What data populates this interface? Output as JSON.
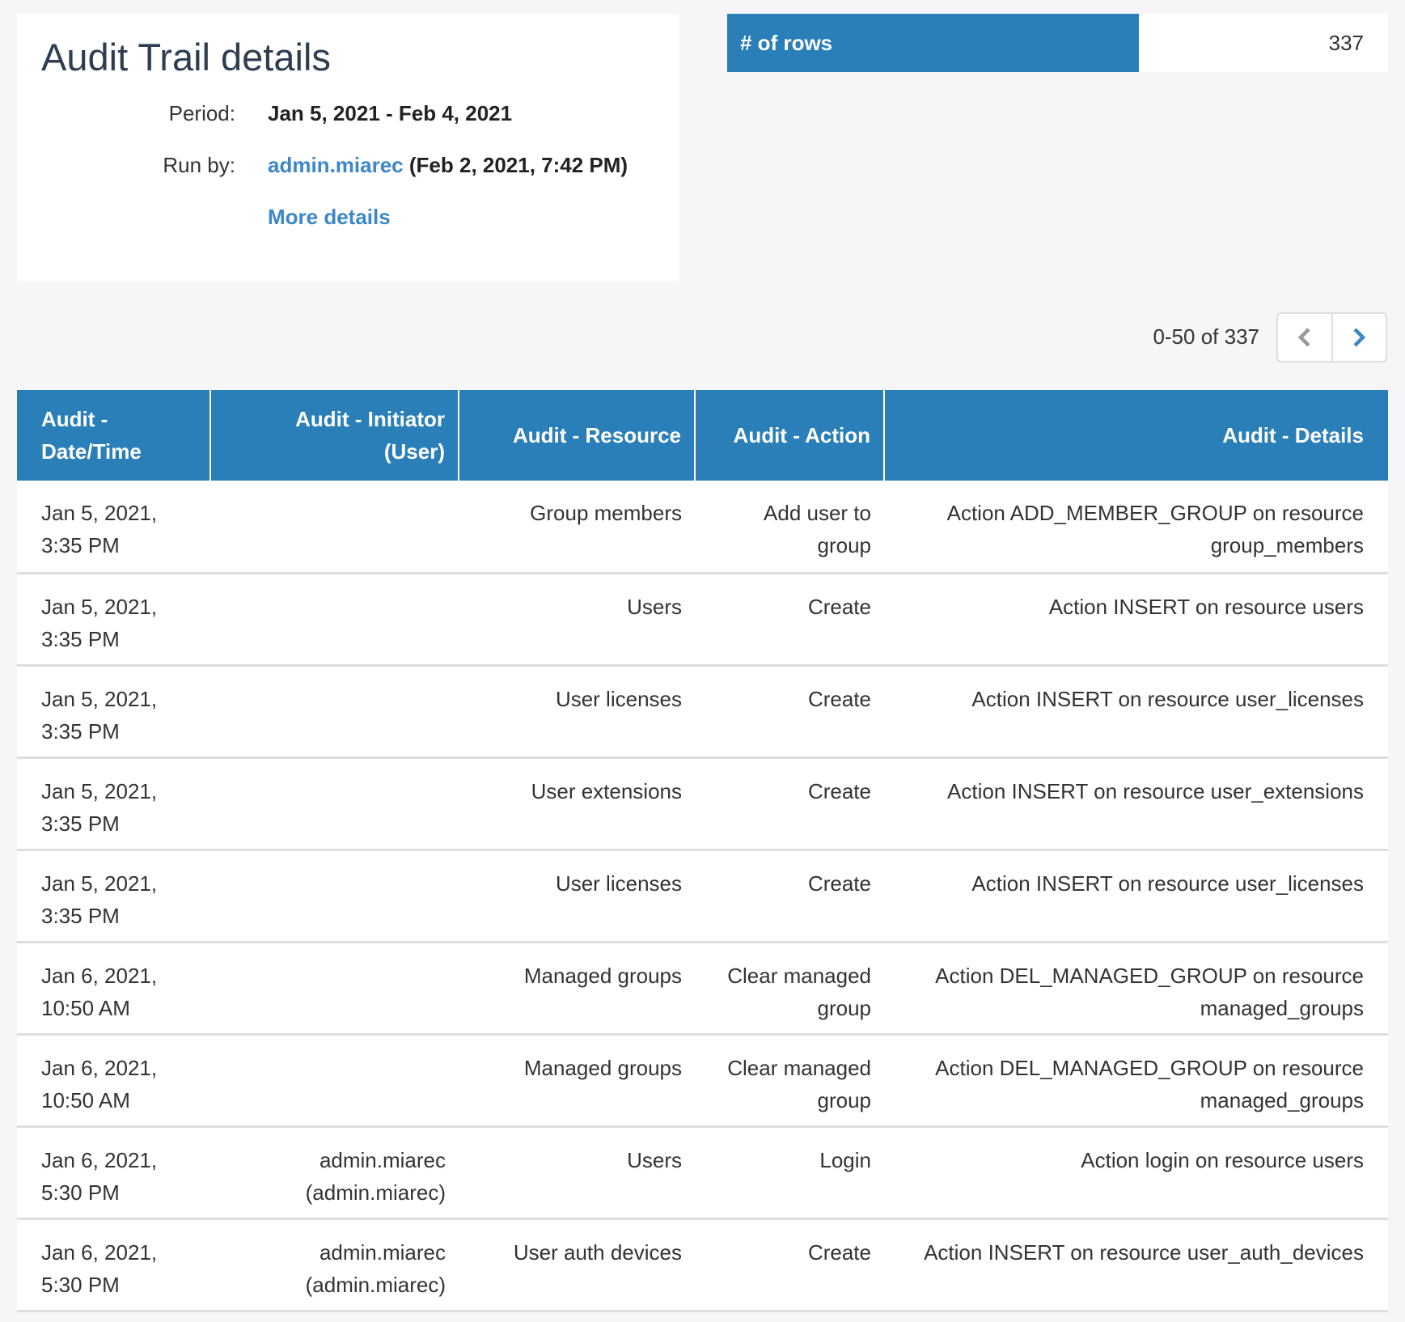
{
  "report": {
    "title": "Audit Trail details",
    "period_label": "Period:",
    "period_value": "Jan 5, 2021 - Feb 4, 2021",
    "run_by_label": "Run by:",
    "run_by_user": "admin.miarec",
    "run_by_time": "(Feb 2, 2021, 7:42 PM)",
    "more_details": "More details"
  },
  "summary": {
    "rows_label": "# of rows",
    "rows_value": "337"
  },
  "pagination": {
    "range_text": "0-50 of 337",
    "prev_icon": "chevron-left-icon",
    "next_icon": "chevron-right-icon"
  },
  "colors": {
    "header_blue": "#2a7fb8",
    "link_blue": "#3d87c9"
  },
  "table": {
    "columns": [
      "Audit - Date/Time",
      "Audit - Initiator (User)",
      "Audit - Resource",
      "Audit - Action",
      "Audit - Details"
    ],
    "rows": [
      {
        "datetime": "Jan 5, 2021, 3:35 PM",
        "initiator": "",
        "resource": "Group members",
        "action": "Add user to group",
        "details": "Action ADD_MEMBER_GROUP on resource group_members"
      },
      {
        "datetime": "Jan 5, 2021, 3:35 PM",
        "initiator": "",
        "resource": "Users",
        "action": "Create",
        "details": "Action INSERT on resource users"
      },
      {
        "datetime": "Jan 5, 2021, 3:35 PM",
        "initiator": "",
        "resource": "User licenses",
        "action": "Create",
        "details": "Action INSERT on resource user_licenses"
      },
      {
        "datetime": "Jan 5, 2021, 3:35 PM",
        "initiator": "",
        "resource": "User extensions",
        "action": "Create",
        "details": "Action INSERT on resource user_extensions"
      },
      {
        "datetime": "Jan 5, 2021, 3:35 PM",
        "initiator": "",
        "resource": "User licenses",
        "action": "Create",
        "details": "Action INSERT on resource user_licenses"
      },
      {
        "datetime": "Jan 6, 2021, 10:50 AM",
        "initiator": "",
        "resource": "Managed groups",
        "action": "Clear managed group",
        "details": "Action DEL_MANAGED_GROUP on resource managed_groups"
      },
      {
        "datetime": "Jan 6, 2021, 10:50 AM",
        "initiator": "",
        "resource": "Managed groups",
        "action": "Clear managed group",
        "details": "Action DEL_MANAGED_GROUP on resource managed_groups"
      },
      {
        "datetime": "Jan 6, 2021, 5:30 PM",
        "initiator": "admin.miarec (admin.miarec)",
        "resource": "Users",
        "action": "Login",
        "details": "Action login on resource users"
      },
      {
        "datetime": "Jan 6, 2021, 5:30 PM",
        "initiator": "admin.miarec (admin.miarec)",
        "resource": "User auth devices",
        "action": "Create",
        "details": "Action INSERT on resource user_auth_devices"
      }
    ]
  }
}
